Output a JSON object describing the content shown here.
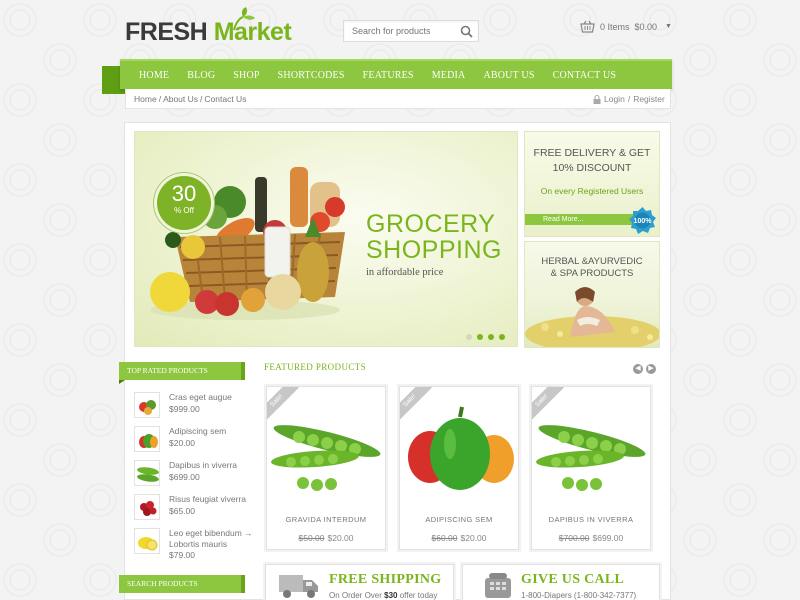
{
  "header": {
    "logo_word1": "FRESH",
    "logo_word2": "Market",
    "search_placeholder": "Search for products",
    "cart_items": "0 Items",
    "cart_total": "$0.00"
  },
  "nav": {
    "items": [
      "HOME",
      "BLOG",
      "SHOP",
      "SHORTCODES",
      "FEATURES",
      "MEDIA",
      "ABOUT US",
      "CONTACT US"
    ]
  },
  "breadcrumb": {
    "items": [
      "Home",
      "About Us",
      "Contact Us"
    ],
    "separator": "/"
  },
  "account": {
    "login": "Login",
    "separator": "/",
    "register": "Register"
  },
  "hero": {
    "badge_number": "30",
    "badge_text": "% Off",
    "title_line1": "GROCERY",
    "title_line2": "SHOPPING",
    "subtitle": "in affordable price",
    "slide_count": 4,
    "active_slide": 1
  },
  "promo_delivery": {
    "line1": "FREE DELIVERY & GET",
    "line2": "10% DISCOUNT",
    "line3": "On every Registered Users",
    "read_more": "Read More...",
    "badge": "100%"
  },
  "promo_herbal": {
    "line1": "HERBAL &AYURVEDIC",
    "line2": "& SPA PRODUCTS"
  },
  "sidebar": {
    "top_rated_title": "TOP RATED PRODUCTS",
    "products": [
      {
        "name": "Cras eget augue",
        "price": "$999.00",
        "icon": "vegetable-mix-icon"
      },
      {
        "name": "Adipiscing sem",
        "price": "$20.00",
        "icon": "bell-pepper-icon"
      },
      {
        "name": "Dapibus in viverra",
        "price": "$699.00",
        "icon": "pea-pod-icon"
      },
      {
        "name": "Risus feugiat viverra",
        "price": "$65.00",
        "icon": "berries-icon"
      },
      {
        "name": "Leo eget bibendum → Lobortis mauris",
        "price": "$79.00",
        "icon": "lemon-icon"
      }
    ],
    "search_title": "SEARCH PRODUCTS"
  },
  "featured": {
    "title": "FEATURED PRODUCTS",
    "products": [
      {
        "name": "GRAVIDA INTERDUM",
        "old_price": "$50.00",
        "price": "$20.00",
        "sale": "Sale!",
        "icon": "pea-pod-icon"
      },
      {
        "name": "ADIPISCING SEM",
        "old_price": "$60.00",
        "price": "$20.00",
        "sale": "Sale!",
        "icon": "bell-pepper-icon"
      },
      {
        "name": "DAPIBUS IN VIVERRA",
        "old_price": "$700.00",
        "price": "$699.00",
        "sale": "Sale!",
        "icon": "pea-pod-icon"
      }
    ]
  },
  "info_boxes": [
    {
      "title": "FREE SHIPPING",
      "sub_prefix": "On Order Over ",
      "sub_bold": "$30",
      "sub_suffix": " offer today",
      "icon": "truck-icon"
    },
    {
      "title": "GIVE US CALL",
      "sub_prefix": "1-800-Diapers (1-800-342-7377)",
      "sub_bold": "",
      "sub_suffix": "",
      "icon": "phone-icon"
    }
  ],
  "colors": {
    "accent": "#8dc63f",
    "accent_dark": "#6aa41b",
    "text": "#666666"
  }
}
